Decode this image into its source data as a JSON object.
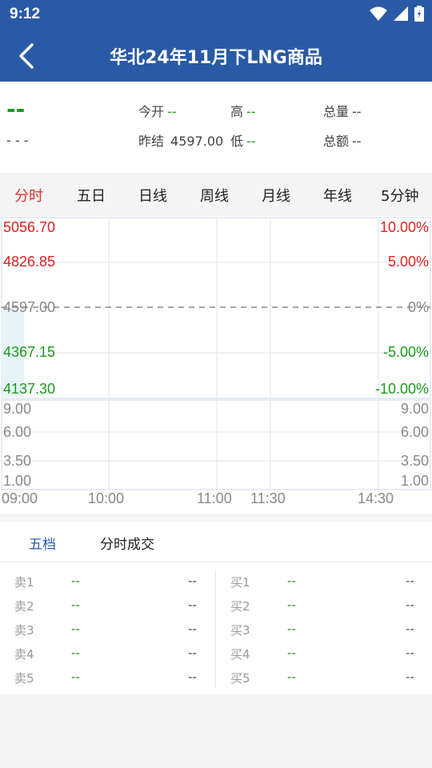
{
  "status": {
    "time": "9:12"
  },
  "header": {
    "title": "华北24年11月下LNG商品"
  },
  "quote": {
    "price": "--",
    "change": "- - -",
    "open_label": "今开",
    "open_value": "--",
    "high_label": "高",
    "high_value": "--",
    "total_volume_label": "总量",
    "total_volume_value": "--",
    "prev_settle_label": "昨结",
    "prev_settle_value": "4597.00",
    "low_label": "低",
    "low_value": "--",
    "total_amount_label": "总额",
    "total_amount_value": "--"
  },
  "tabs": [
    "分时",
    "五日",
    "日线",
    "周线",
    "月线",
    "年线",
    "5分钟"
  ],
  "active_tab": 0,
  "chart": {
    "price_labels": [
      "5056.70",
      "4826.85",
      "4597.00",
      "4367.15",
      "4137.30"
    ],
    "pct_labels": [
      "10.00%",
      "5.00%",
      "0%",
      "-5.00%",
      "-10.00%"
    ],
    "volume_labels": [
      "9.00",
      "6.00",
      "3.50",
      "1.00"
    ],
    "time_labels": [
      "09:00",
      "10:00",
      "11:00",
      "11:30",
      "14:30"
    ]
  },
  "orderbook": {
    "tabs": [
      "五档",
      "分时成交"
    ],
    "sell": [
      {
        "label": "卖1",
        "price": "--",
        "vol": "--"
      },
      {
        "label": "卖2",
        "price": "--",
        "vol": "--"
      },
      {
        "label": "卖3",
        "price": "--",
        "vol": "--"
      },
      {
        "label": "卖4",
        "price": "--",
        "vol": "--"
      },
      {
        "label": "卖5",
        "price": "--",
        "vol": "--"
      }
    ],
    "buy": [
      {
        "label": "买1",
        "price": "--",
        "vol": "--"
      },
      {
        "label": "买2",
        "price": "--",
        "vol": "--"
      },
      {
        "label": "买3",
        "price": "--",
        "vol": "--"
      },
      {
        "label": "买4",
        "price": "--",
        "vol": "--"
      },
      {
        "label": "买5",
        "price": "--",
        "vol": "--"
      }
    ]
  }
}
